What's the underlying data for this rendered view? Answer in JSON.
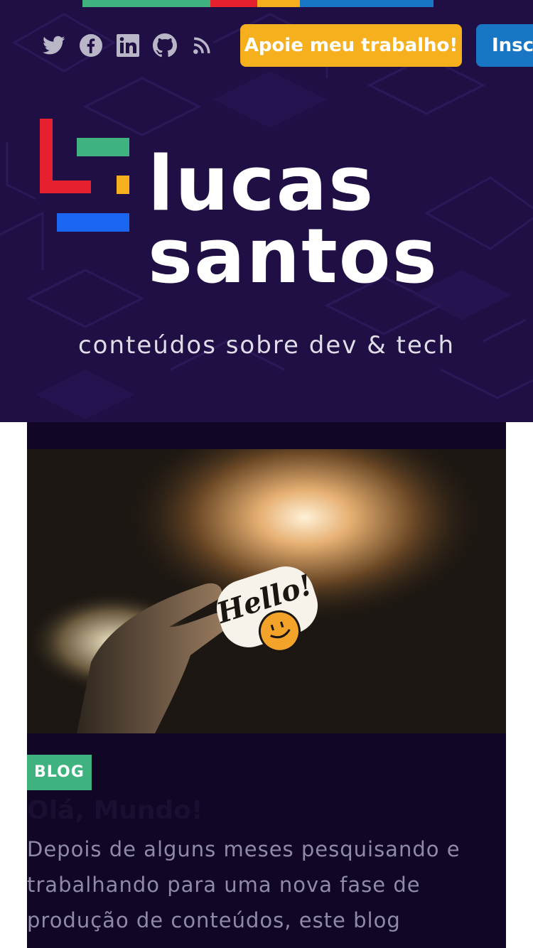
{
  "header": {
    "accent_colors": [
      "#3fb27f",
      "#e7202f",
      "#f6b01e",
      "#1976c5"
    ],
    "social_icons": [
      "twitter-icon",
      "facebook-icon",
      "linkedin-icon",
      "github-icon",
      "rss-icon"
    ],
    "support_label": "Apoie meu trabalho!",
    "subscribe_label": "Inscr",
    "logo_line1": "LUCAS",
    "logo_line2": "SANTOS",
    "tagline": "conteúdos sobre dev & tech"
  },
  "post": {
    "category": "BLOG",
    "title": "Olá, Mundo!",
    "excerpt": "Depois de alguns meses pesquisando e trabalhando para uma nova fase de produção de conteúdos, este blog",
    "image_sticker_text": "Hello!",
    "image_icon": "hello-sticker-image"
  },
  "colors": {
    "hero_bg": "#200f44",
    "card_bg": "#110626",
    "support_button": "#f6b01e",
    "subscribe_button": "#1976c5",
    "badge": "#3fb27f"
  }
}
